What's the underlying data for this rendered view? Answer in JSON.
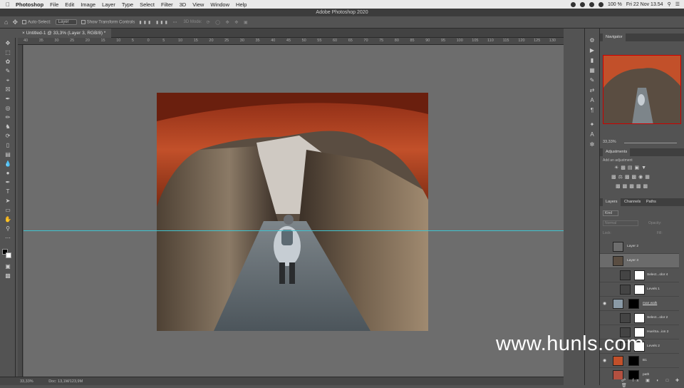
{
  "menubar": {
    "app": "Photoshop",
    "menus": [
      "File",
      "Edit",
      "Image",
      "Layer",
      "Type",
      "Select",
      "Filter",
      "3D",
      "View",
      "Window",
      "Help"
    ],
    "battery": "100 %",
    "datetime": "Fri 22 Nov 13.54"
  },
  "window_title": "Adobe Photoshop 2020",
  "options_bar": {
    "auto_select_label": "Auto-Select:",
    "auto_select_value": "Layer",
    "transform_label": "Show Transform Controls",
    "mode_3d": "3D Mode:"
  },
  "document_tab": "Untitled-1 @ 33,3% (Layer 3, RGB/8) *",
  "ruler_ticks": [
    "40",
    "35",
    "30",
    "25",
    "20",
    "15",
    "10",
    "5",
    "0",
    "5",
    "10",
    "15",
    "20",
    "25",
    "30",
    "35",
    "40",
    "45",
    "50",
    "55",
    "60",
    "65",
    "70",
    "75",
    "80",
    "85",
    "90",
    "95",
    "100",
    "105",
    "110",
    "115",
    "120",
    "125",
    "130"
  ],
  "status": {
    "zoom": "33,33%",
    "doc": "Doc: 13,1M/123,9M"
  },
  "navigator": {
    "title": "Navigator",
    "zoom": "33,33%"
  },
  "adjustments": {
    "title": "Adjustments",
    "subtitle": "Add an adjustment"
  },
  "layers_panel": {
    "tabs": [
      "Layers",
      "Channels",
      "Paths"
    ],
    "filter_kind": "Kind",
    "blend_mode": "Normal",
    "opacity_label": "Opacity:",
    "lock_label": "Lock:",
    "fill_label": "Fill:",
    "layers": [
      {
        "name": "Layer 2",
        "visible": false
      },
      {
        "name": "Layer 3",
        "visible": false
      },
      {
        "name": "Select...olor 4",
        "visible": false
      },
      {
        "name": "Levels 1",
        "visible": false
      },
      {
        "name": "man walk",
        "visible": true
      },
      {
        "name": "Select...olor 2",
        "visible": false
      },
      {
        "name": "Hue/Sa...ion 2",
        "visible": false
      },
      {
        "name": "Levels 2",
        "visible": false
      },
      {
        "name": "B1",
        "visible": true
      },
      {
        "name": "path",
        "visible": false
      }
    ]
  },
  "watermark": "www.hunls.com",
  "colors": {
    "guide": "#3fc4d0",
    "rock": "#c2502a"
  }
}
